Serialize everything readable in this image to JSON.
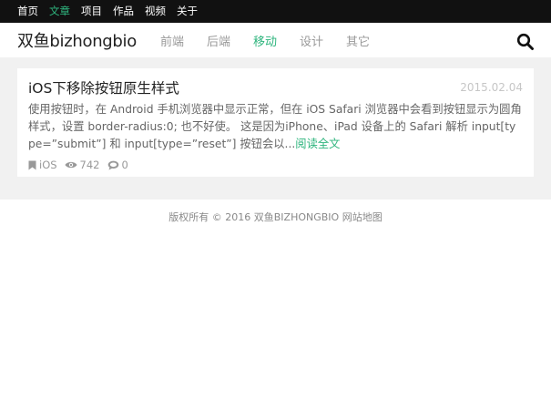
{
  "topbar": {
    "links": [
      "首页",
      "文章",
      "项目",
      "作品",
      "视频",
      "关于"
    ],
    "active_index": 1
  },
  "header": {
    "logo": "双鱼bizhongbio",
    "nav": [
      "前端",
      "后端",
      "移动",
      "设计",
      "其它"
    ],
    "active_nav_index": 2,
    "search_icon": "search-icon"
  },
  "article": {
    "title": "iOS下移除按钮原生样式",
    "date": "2015.02.04",
    "excerpt": "使用按钮时，在 Android 手机浏览器中显示正常，但在 iOS Safari 浏览器中会看到按钮显示为圆角样式，设置 border-radius:0; 也不好使。 这是因为iPhone、iPad 设备上的 Safari 解析 input[type=”submit”] 和 input[type=”reset”] 按钮会以...",
    "read_more": "阅读全文",
    "tag": "iOS",
    "views": "742",
    "comments": "0"
  },
  "footer": {
    "copyright": "版权所有 © 2016 双鱼BIZHONGBIO",
    "sitemap": "网站地图"
  },
  "colors": {
    "accent": "#2fb57e",
    "topbar_bg": "#111111",
    "page_bg": "#f1f1f1"
  }
}
